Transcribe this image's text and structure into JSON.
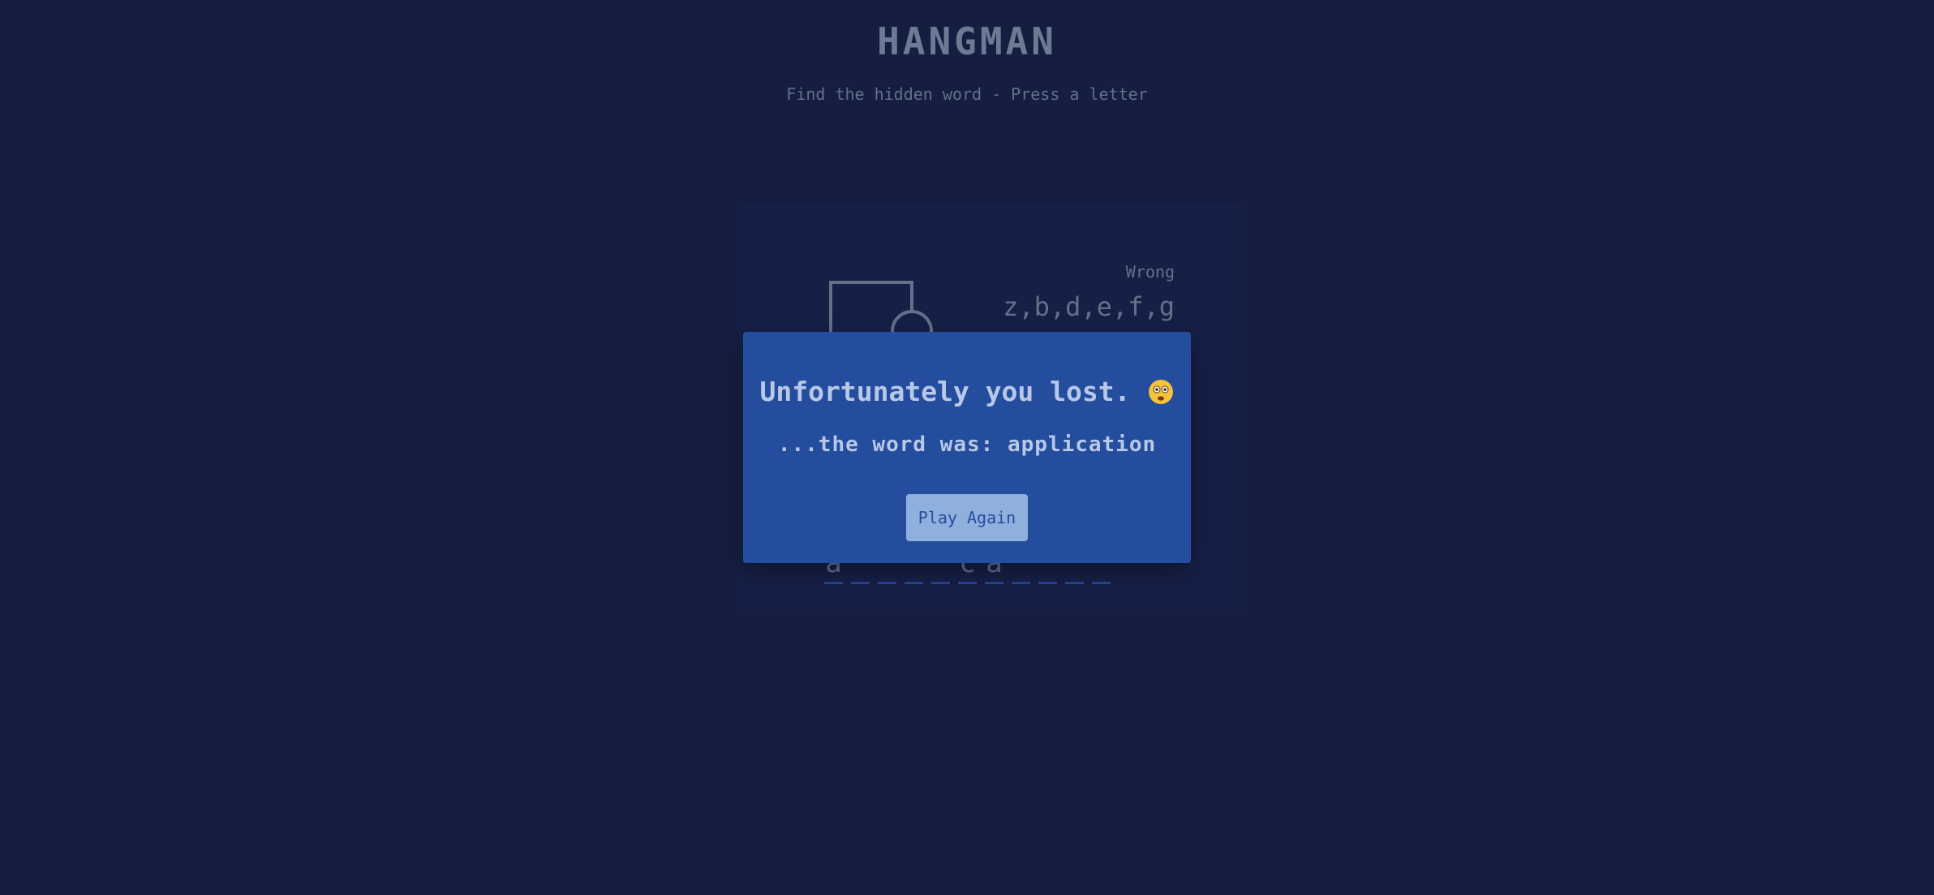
{
  "header": {
    "title": "HANGMAN",
    "subtitle": "Find the hidden word - Press a letter"
  },
  "wrong": {
    "label": "Wrong",
    "letters": "z,b,d,e,f,g"
  },
  "word": {
    "slots": [
      "a",
      "",
      "",
      "",
      "",
      "c",
      "a",
      "",
      "",
      "",
      ""
    ]
  },
  "popup": {
    "heading": "Unfortunately you lost.",
    "word_line": "...the word was: application",
    "button_label": "Play Again"
  },
  "colors": {
    "background": "#172044",
    "modal": "#244d9e",
    "button": "#8fb0dd",
    "text": "#b8c8e8"
  }
}
